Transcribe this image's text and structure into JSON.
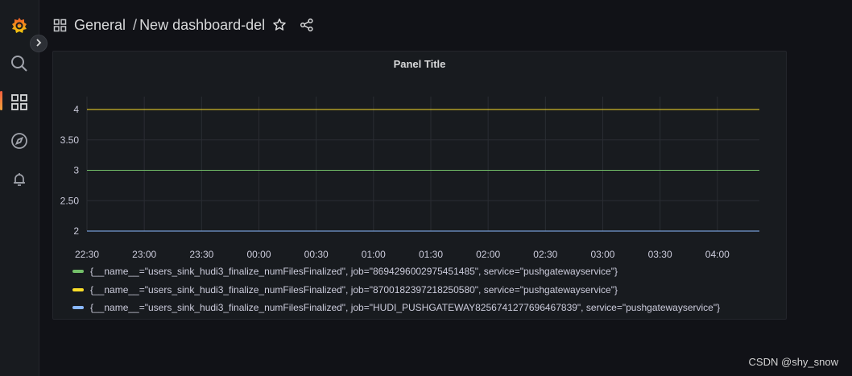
{
  "sidebar": {
    "items": [
      {
        "icon": "grafana-logo-icon"
      },
      {
        "icon": "search-icon"
      },
      {
        "icon": "dashboards-icon",
        "active": true
      },
      {
        "icon": "explore-compass-icon"
      },
      {
        "icon": "alerting-bell-icon"
      }
    ],
    "expand_icon": "chevron-right-icon"
  },
  "breadcrumb": {
    "folder": "General",
    "separator": "/",
    "dashboard": "New dashboard-del"
  },
  "panel": {
    "title": "Panel Title"
  },
  "chart_data": {
    "type": "line",
    "title": "Panel Title",
    "x": [
      "22:30",
      "23:00",
      "23:30",
      "00:00",
      "00:30",
      "01:00",
      "01:30",
      "02:00",
      "02:30",
      "03:00",
      "03:30",
      "04:00"
    ],
    "x_range": [
      "22:30",
      "04:22"
    ],
    "yticks": [
      "2",
      "2.50",
      "3",
      "3.50",
      "4"
    ],
    "ylim": [
      2,
      4
    ],
    "grid": true,
    "legend_position": "bottom",
    "series": [
      {
        "name": "{__name__=\"users_sink_hudi3_finalize_numFilesFinalized\", job=\"8694296002975451485\", service=\"pushgatewayservice\"}",
        "color": "#73bf69",
        "value": 3
      },
      {
        "name": "{__name__=\"users_sink_hudi3_finalize_numFilesFinalized\", job=\"8700182397218250580\", service=\"pushgatewayservice\"}",
        "color": "#fade2a",
        "value": 4
      },
      {
        "name": "{__name__=\"users_sink_hudi3_finalize_numFilesFinalized\", job=\"HUDI_PUSHGATEWAY8256741277696467839\", service=\"pushgatewayservice\"}",
        "color": "#8ab8ff",
        "value": 2
      }
    ]
  },
  "watermark": "CSDN @shy_snow",
  "colors": {
    "background": "#111217",
    "panel": "#181b1f",
    "accent": "#f55f3e"
  }
}
